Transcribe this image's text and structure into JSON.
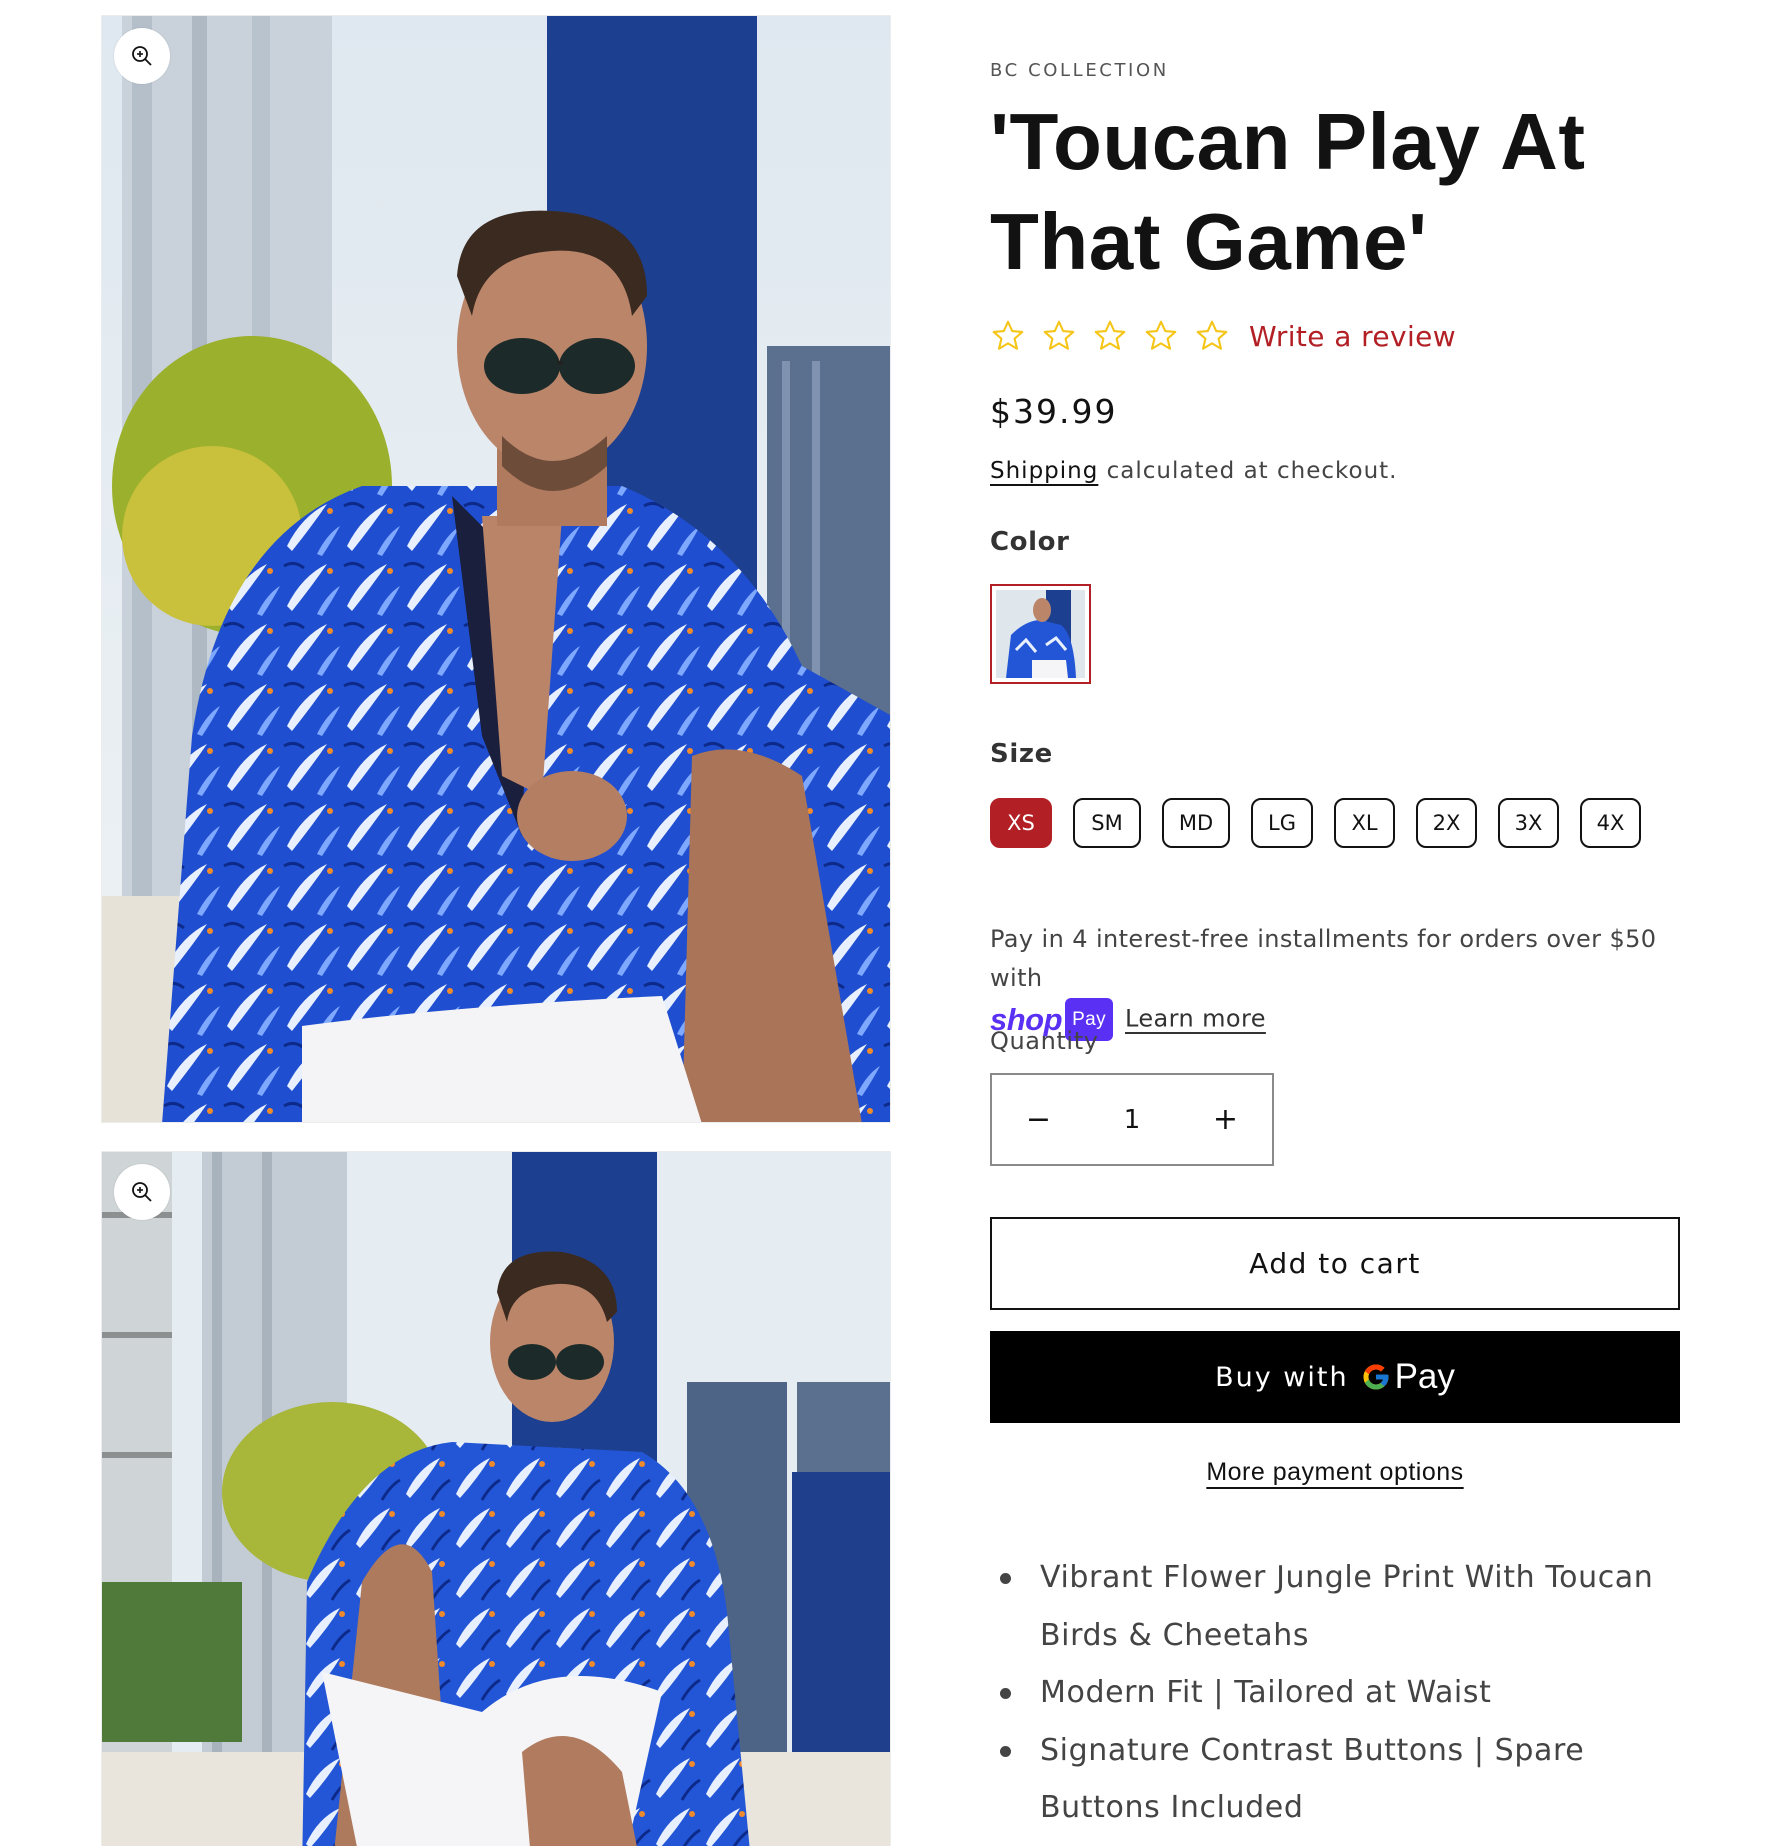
{
  "gallery": {
    "images": [
      {
        "alt": "Model in blue toucan print shirt seated by pool",
        "zoom_icon": "zoom-in-icon"
      },
      {
        "alt": "Model in blue toucan print shirt seated, wide shot",
        "zoom_icon": "zoom-in-icon"
      }
    ]
  },
  "product": {
    "vendor": "BC COLLECTION",
    "title": "'Toucan Play At That Game'",
    "rating": {
      "stars": 0,
      "max": 5,
      "write_review": "Write a review"
    },
    "price": "$39.99",
    "shipping_link": "Shipping",
    "shipping_text": " calculated at checkout.",
    "color_label": "Color",
    "size_label": "Size",
    "sizes": [
      "XS",
      "SM",
      "MD",
      "LG",
      "XL",
      "2X",
      "3X",
      "4X"
    ],
    "selected_size": "XS",
    "installments_text": "Pay in 4 interest-free installments for orders over $50 with",
    "shoppay_word": "shop",
    "shoppay_pill": "Pay",
    "learn_more": "Learn more",
    "quantity_label": "Quantity",
    "quantity_value": "1",
    "quantity_decrease": "−",
    "quantity_increase": "+",
    "add_to_cart": "Add to cart",
    "buy_with": "Buy with",
    "gpay_word": "Pay",
    "more_payment": "More payment options",
    "features": [
      "Vibrant Flower Jungle Print With Toucan Birds & Cheetahs",
      "Modern Fit | Tailored at Waist",
      "Signature Contrast Buttons | Spare Buttons Included"
    ]
  },
  "colors": {
    "accent": "#b22025",
    "star": "#f5c518",
    "shoppay": "#5a31f4",
    "gpay_bg": "#000000"
  }
}
